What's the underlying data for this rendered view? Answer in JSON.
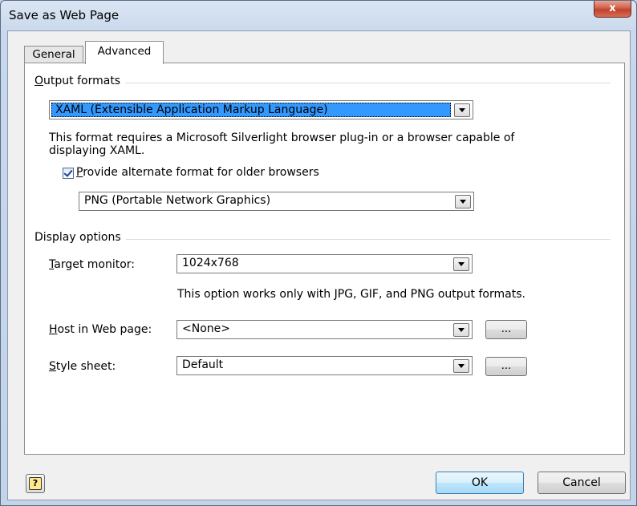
{
  "window": {
    "title": "Save as Web Page",
    "close_label": "x"
  },
  "tabs": [
    {
      "label": "General",
      "selected": false
    },
    {
      "label": "Advanced",
      "selected": true
    }
  ],
  "output_formats": {
    "group_label_mnemonic": "O",
    "group_label_rest": "utput formats",
    "format_value": "XAML (Extensible Application Markup Language)",
    "description_line1": "This format requires a Microsoft Silverlight browser plug-in or a browser capable of",
    "description_line2": "displaying XAML.",
    "alternate_checkbox": {
      "checked": true,
      "label_mnemonic": "P",
      "label_rest": "rovide alternate format for older browsers"
    },
    "alternate_value": "PNG (Portable Network Graphics)"
  },
  "display_options": {
    "group_label": "Display options",
    "target_monitor_mnemonic": "T",
    "target_monitor_rest": "arget monitor:",
    "target_monitor_value": "1024x768",
    "target_note": "This option works only with JPG, GIF, and PNG output formats.",
    "host_mnemonic": "H",
    "host_rest": "ost in Web page:",
    "host_value": "<None>",
    "host_browse": "...",
    "style_mnemonic": "S",
    "style_rest": "tyle sheet:",
    "style_value": "Default",
    "style_browse": "..."
  },
  "footer": {
    "help_glyph": "?",
    "ok_label": "OK",
    "cancel_label": "Cancel"
  },
  "colors": {
    "selection": "#3399ff",
    "title_bar": "#c9d8ec",
    "close_button": "#c2412a"
  }
}
